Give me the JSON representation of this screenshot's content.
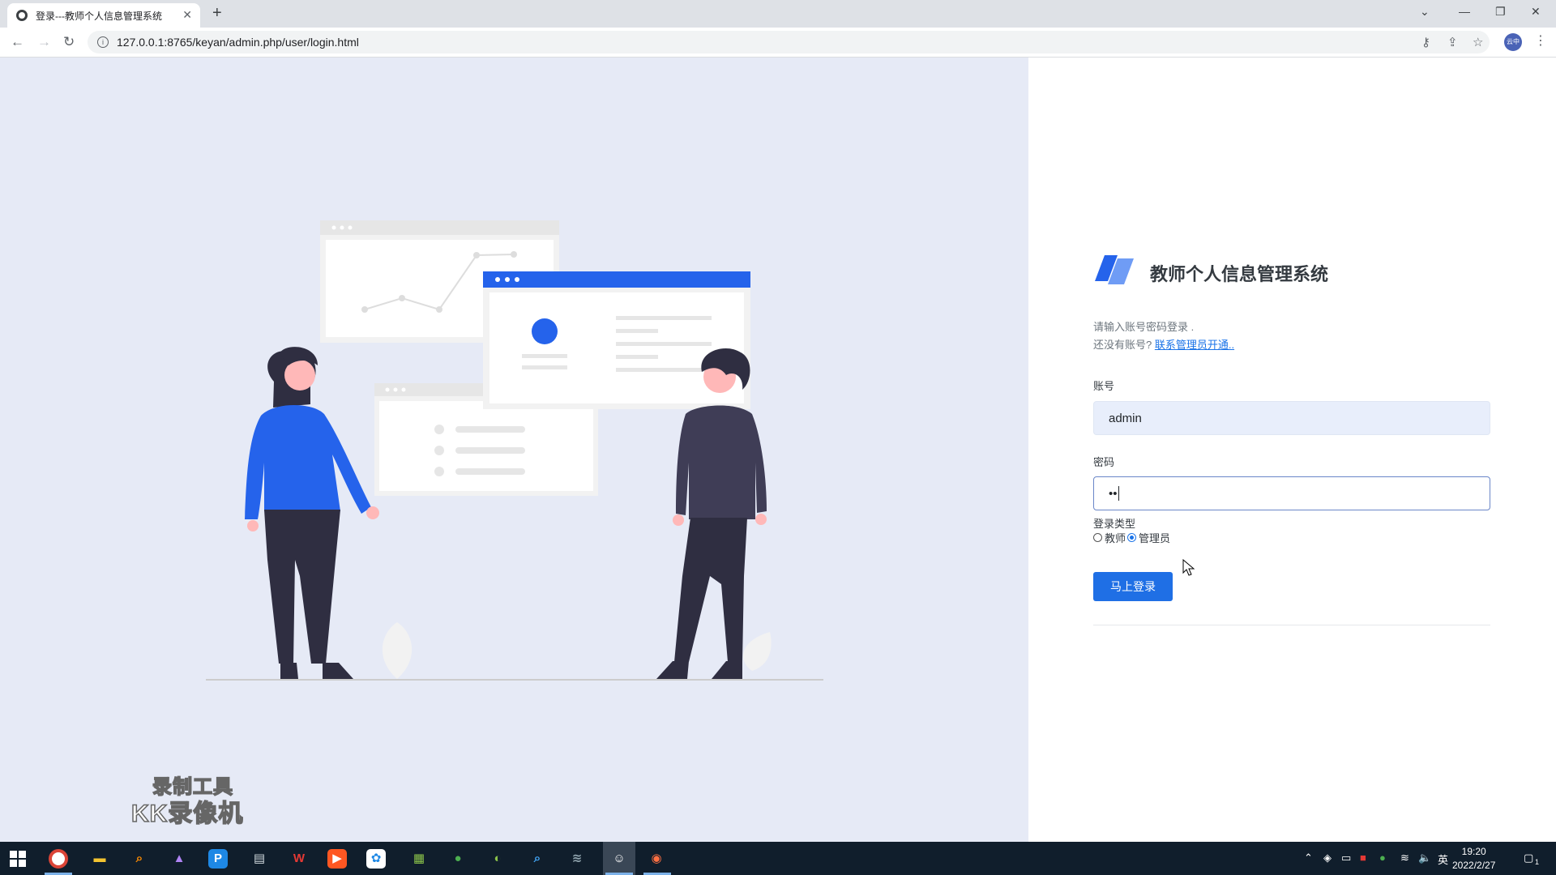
{
  "browser": {
    "tab_title": "登录---教师个人信息管理系统",
    "url": "127.0.0.1:8765/keyan/admin.php/user/login.html",
    "profile_label": "云中"
  },
  "login": {
    "system_title": "教师个人信息管理系统",
    "hint_line1": "请输入账号密码登录 .",
    "hint_line2_prefix": "还没有账号? ",
    "hint_link": "联系管理员开通..",
    "account_label": "账号",
    "account_value": "admin",
    "password_label": "密码",
    "password_value": "••",
    "type_label": "登录类型",
    "type_options": [
      {
        "label": "教师",
        "selected": false
      },
      {
        "label": "管理员",
        "selected": true
      }
    ],
    "submit_label": "马上登录"
  },
  "watermark": {
    "line1": "录制工具",
    "line2": "KK录像机"
  },
  "taskbar": {
    "apps": [
      "chrome-icon",
      "file-explorer-icon",
      "search-tool-icon",
      "photos-icon",
      "p-app-icon",
      "printer-app-icon",
      "wps-icon",
      "media-app-icon",
      "network-app-icon",
      "notepad-icon",
      "wechat-icon",
      "green-app-icon",
      "zoom-search-icon",
      "editor-app-icon",
      "avatar-app-icon",
      "orange-app-icon"
    ],
    "ime": "英",
    "time": "19:20",
    "date": "2022/2/27",
    "notifications": "1"
  },
  "colors": {
    "accent": "#1f6fe5",
    "left_bg": "#e6eaf6",
    "taskbar_bg": "#101e2c"
  }
}
